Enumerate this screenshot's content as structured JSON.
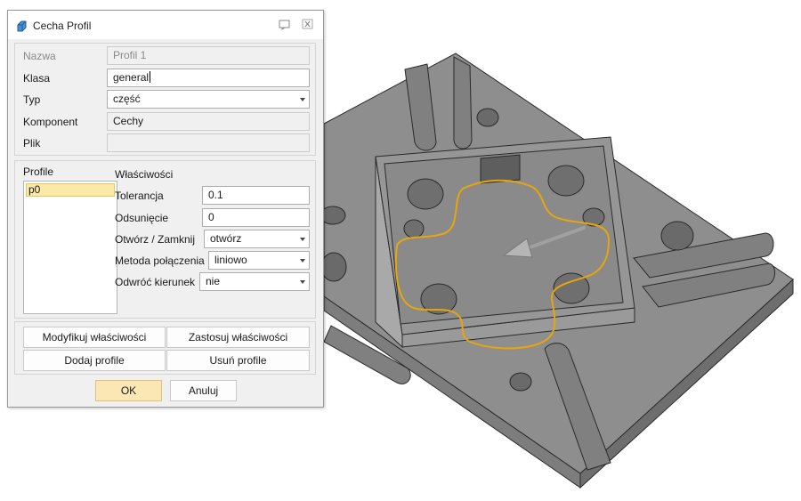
{
  "dialog": {
    "title": "Cecha Profil",
    "icon": "feature-icon",
    "controls": {
      "restore_icon": "restore-window-icon",
      "close_icon": "close-icon"
    }
  },
  "general": {
    "name_label": "Nazwa",
    "name_value": "Profil 1",
    "class_label": "Klasa",
    "class_value": "general",
    "type_label": "Typ",
    "type_value": "część",
    "component_label": "Komponent",
    "component_value": "Cechy",
    "file_label": "Plik",
    "file_value": ""
  },
  "profiles": {
    "header": "Profile",
    "items": [
      "p0"
    ],
    "selected": "p0"
  },
  "properties": {
    "header": "Właściwości",
    "tolerance_label": "Tolerancja",
    "tolerance_value": "0.1",
    "offset_label": "Odsunięcie",
    "offset_value": "0",
    "open_close_label": "Otwórz  / Zamknij",
    "open_close_value": "otwórz",
    "join_method_label": "Metoda połączenia",
    "join_method_value": "liniowo",
    "reverse_label": "Odwróć kierunek",
    "reverse_value": "nie"
  },
  "actions": {
    "modify": "Modyfikuj właściwości",
    "apply": "Zastosuj właściwości",
    "add": "Dodaj profile",
    "remove": "Usuń profile"
  },
  "footer": {
    "ok": "OK",
    "cancel": "Anuluj"
  },
  "colors": {
    "profile_curve": "#e8a50c",
    "part_face": "#8c8c8c",
    "part_side": "#7a7a7a",
    "selection": "#fbe9a8"
  }
}
